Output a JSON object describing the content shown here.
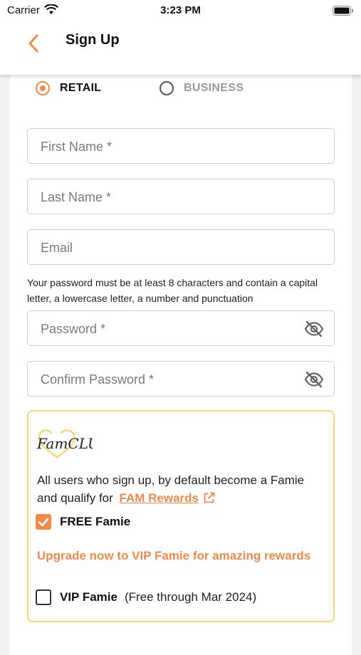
{
  "status_bar": {
    "carrier": "Carrier",
    "time": "3:23 PM"
  },
  "header": {
    "title": "Sign Up"
  },
  "account_type": {
    "options": [
      {
        "label": "RETAIL",
        "selected": true
      },
      {
        "label": "BUSINESS",
        "selected": false
      }
    ]
  },
  "form": {
    "first_name": {
      "placeholder": "First Name *",
      "value": ""
    },
    "last_name": {
      "placeholder": "Last Name *",
      "value": ""
    },
    "email": {
      "placeholder": "Email",
      "value": ""
    },
    "password_hint": "Your password must be at least 8 characters and contain a capital letter, a lowercase letter, a number and punctuation",
    "password": {
      "placeholder": "Password *",
      "value": ""
    },
    "confirm_password": {
      "placeholder": "Confirm Password *",
      "value": ""
    }
  },
  "famclub": {
    "logo_text": "FamCLUB",
    "intro": "All users who sign up, by default become a Famie and qualify for",
    "rewards_link": "FAM Rewards",
    "free_option": {
      "label": "FREE Famie",
      "checked": true
    },
    "upgrade_text": "Upgrade now to VIP Famie for amazing rewards",
    "vip_option": {
      "label": "VIP Famie",
      "note": "(Free through Mar 2024)",
      "checked": false
    }
  },
  "colors": {
    "accent": "#f08a4b",
    "famclub_border": "#f7d778"
  },
  "icons": [
    "wifi-icon",
    "battery-icon",
    "back-chevron-icon",
    "eye-off-icon",
    "external-link-icon",
    "checkmark-icon"
  ]
}
